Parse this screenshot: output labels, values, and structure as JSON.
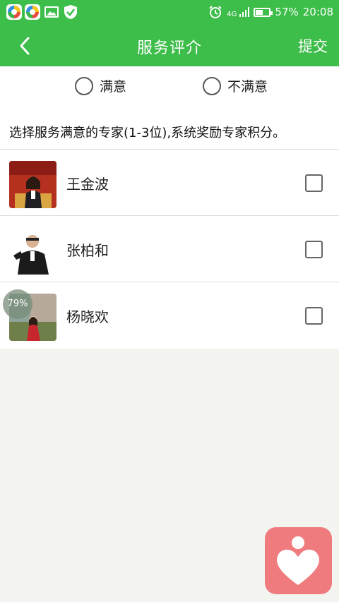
{
  "status_bar": {
    "network": "4G",
    "battery": "57%",
    "battery_level": 0.57,
    "time": "20:08"
  },
  "app_bar": {
    "title": "服务评介",
    "submit_label": "提交"
  },
  "rating": {
    "options": [
      "满意",
      "不满意"
    ]
  },
  "description": "选择服务满意的专家(1-3位),系统奖励专家积分。",
  "experts": [
    {
      "name": "王金波"
    },
    {
      "name": "张柏和"
    },
    {
      "name": "杨晓欢"
    }
  ],
  "overlay_badge": "79%",
  "colors": {
    "brand_green": "#3dbd49",
    "fab_pink": "#ef7b7f"
  }
}
